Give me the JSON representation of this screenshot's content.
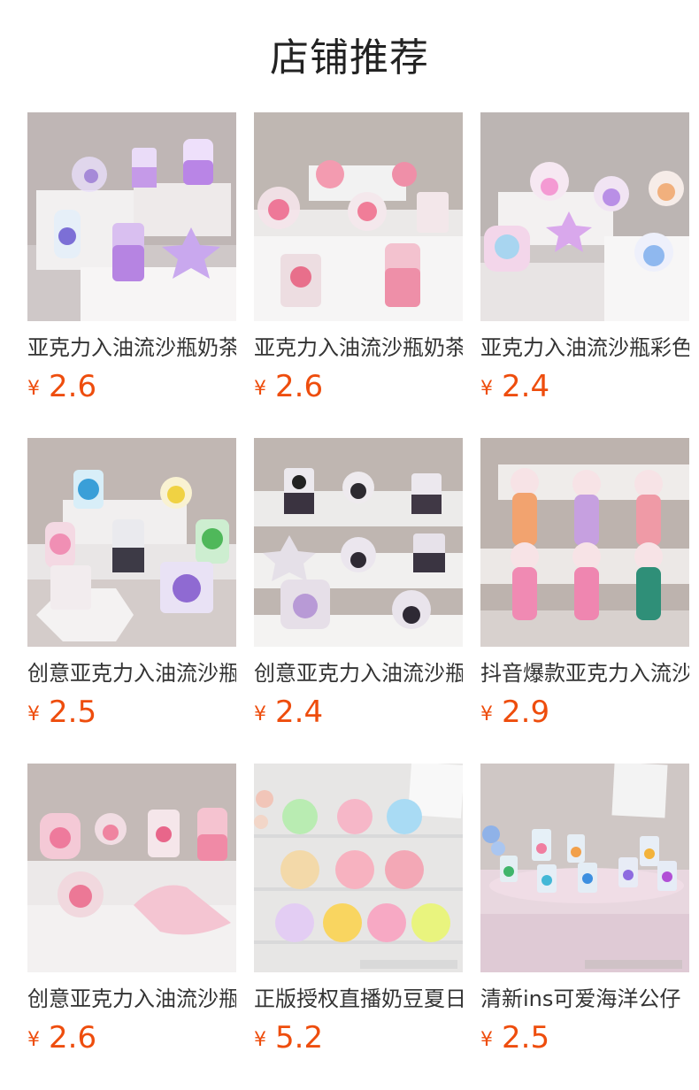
{
  "page": {
    "title": "店铺推荐"
  },
  "colors": {
    "price": "#ee4d0d",
    "title": "#222222",
    "name": "#333333"
  },
  "products": [
    {
      "name": "亚克力入油流沙瓶奶茶",
      "currency": "¥",
      "price": "2.6",
      "image": "purple-bunny-bottles"
    },
    {
      "name": "亚克力入油流沙瓶奶茶",
      "currency": "¥",
      "price": "2.6",
      "image": "pink-bear-bottles"
    },
    {
      "name": "亚克力入油流沙瓶彩色",
      "currency": "¥",
      "price": "2.4",
      "image": "colorful-charm-bottles"
    },
    {
      "name": "创意亚克力入油流沙瓶",
      "currency": "¥",
      "price": "2.5",
      "image": "cartoon-character-bottles"
    },
    {
      "name": "创意亚克力入油流沙瓶",
      "currency": "¥",
      "price": "2.4",
      "image": "panda-bottles"
    },
    {
      "name": "抖音爆款亚克力入流沙",
      "currency": "¥",
      "price": "2.9",
      "image": "bunny-popsicle-charms"
    },
    {
      "name": "创意亚克力入油流沙瓶",
      "currency": "¥",
      "price": "2.6",
      "image": "pink-strawberry-bottles"
    },
    {
      "name": "正版授权直播奶豆夏日",
      "currency": "¥",
      "price": "5.2",
      "image": "doll-face-bottles"
    },
    {
      "name": "清新ins可爱海洋公仔",
      "currency": "¥",
      "price": "2.5",
      "image": "ocean-mini-bottles"
    }
  ]
}
